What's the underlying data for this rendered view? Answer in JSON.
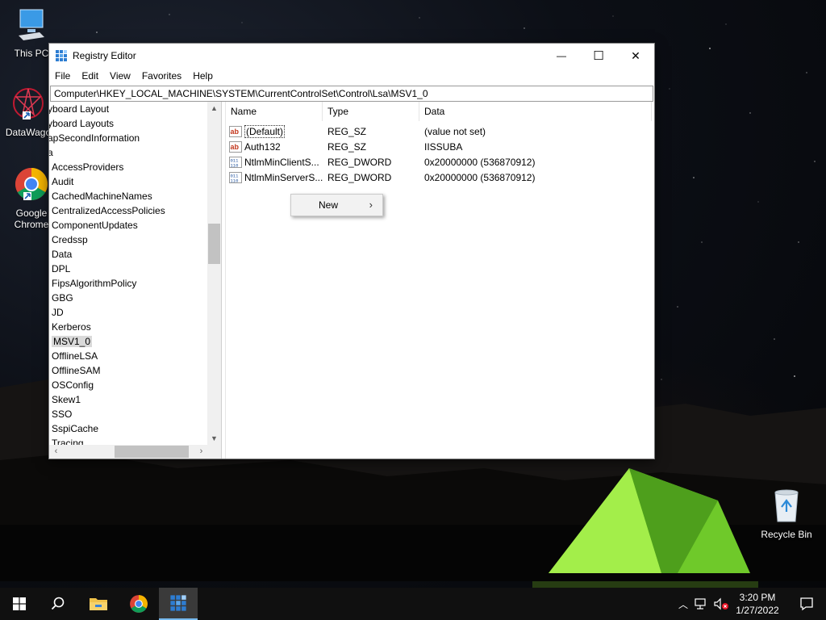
{
  "desktop": {
    "icons": [
      {
        "id": "this-pc",
        "label": "This PC",
        "icon": "monitor-icon"
      },
      {
        "id": "datawago",
        "label": "DataWago",
        "icon": "datawago-icon"
      },
      {
        "id": "chrome",
        "label_line1": "Google",
        "label_line2": "Chrome",
        "icon": "chrome-icon"
      },
      {
        "id": "recycle",
        "label": "Recycle Bin",
        "icon": "recycle-bin-icon"
      }
    ]
  },
  "window": {
    "title": "Registry Editor",
    "controls": {
      "minimize": "—",
      "maximize": "☐",
      "close": "✕"
    },
    "menu": [
      "File",
      "Edit",
      "View",
      "Favorites",
      "Help"
    ],
    "address": "Computer\\HKEY_LOCAL_MACHINE\\SYSTEM\\CurrentControlSet\\Control\\Lsa\\MSV1_0",
    "tree": [
      "yboard Layout",
      "yboard Layouts",
      "apSecondInformation",
      "a",
      "AccessProviders",
      "Audit",
      "CachedMachineNames",
      "CentralizedAccessPolicies",
      "ComponentUpdates",
      "Credssp",
      "Data",
      "DPL",
      "FipsAlgorithmPolicy",
      "GBG",
      "JD",
      "Kerberos",
      "MSV1_0",
      "OfflineLSA",
      "OfflineSAM",
      "OSConfig",
      "Skew1",
      "SSO",
      "SspiCache",
      "Tracing"
    ],
    "columns": {
      "name": "Name",
      "type": "Type",
      "data": "Data"
    },
    "values": [
      {
        "name": "(Default)",
        "type": "REG_SZ",
        "data": "(value not set)",
        "icon": "string-value-icon"
      },
      {
        "name": "Auth132",
        "type": "REG_SZ",
        "data": "IISSUBA",
        "icon": "string-value-icon"
      },
      {
        "name": "NtlmMinClientS...",
        "type": "REG_DWORD",
        "data": "0x20000000 (536870912)",
        "icon": "binary-value-icon"
      },
      {
        "name": "NtlmMinServerS...",
        "type": "REG_DWORD",
        "data": "0x20000000 (536870912)",
        "icon": "binary-value-icon"
      }
    ],
    "context_menu": {
      "label": "New",
      "submenu_arrow": "›"
    }
  },
  "taskbar": {
    "time": "3:20 PM",
    "date": "1/27/2022"
  }
}
